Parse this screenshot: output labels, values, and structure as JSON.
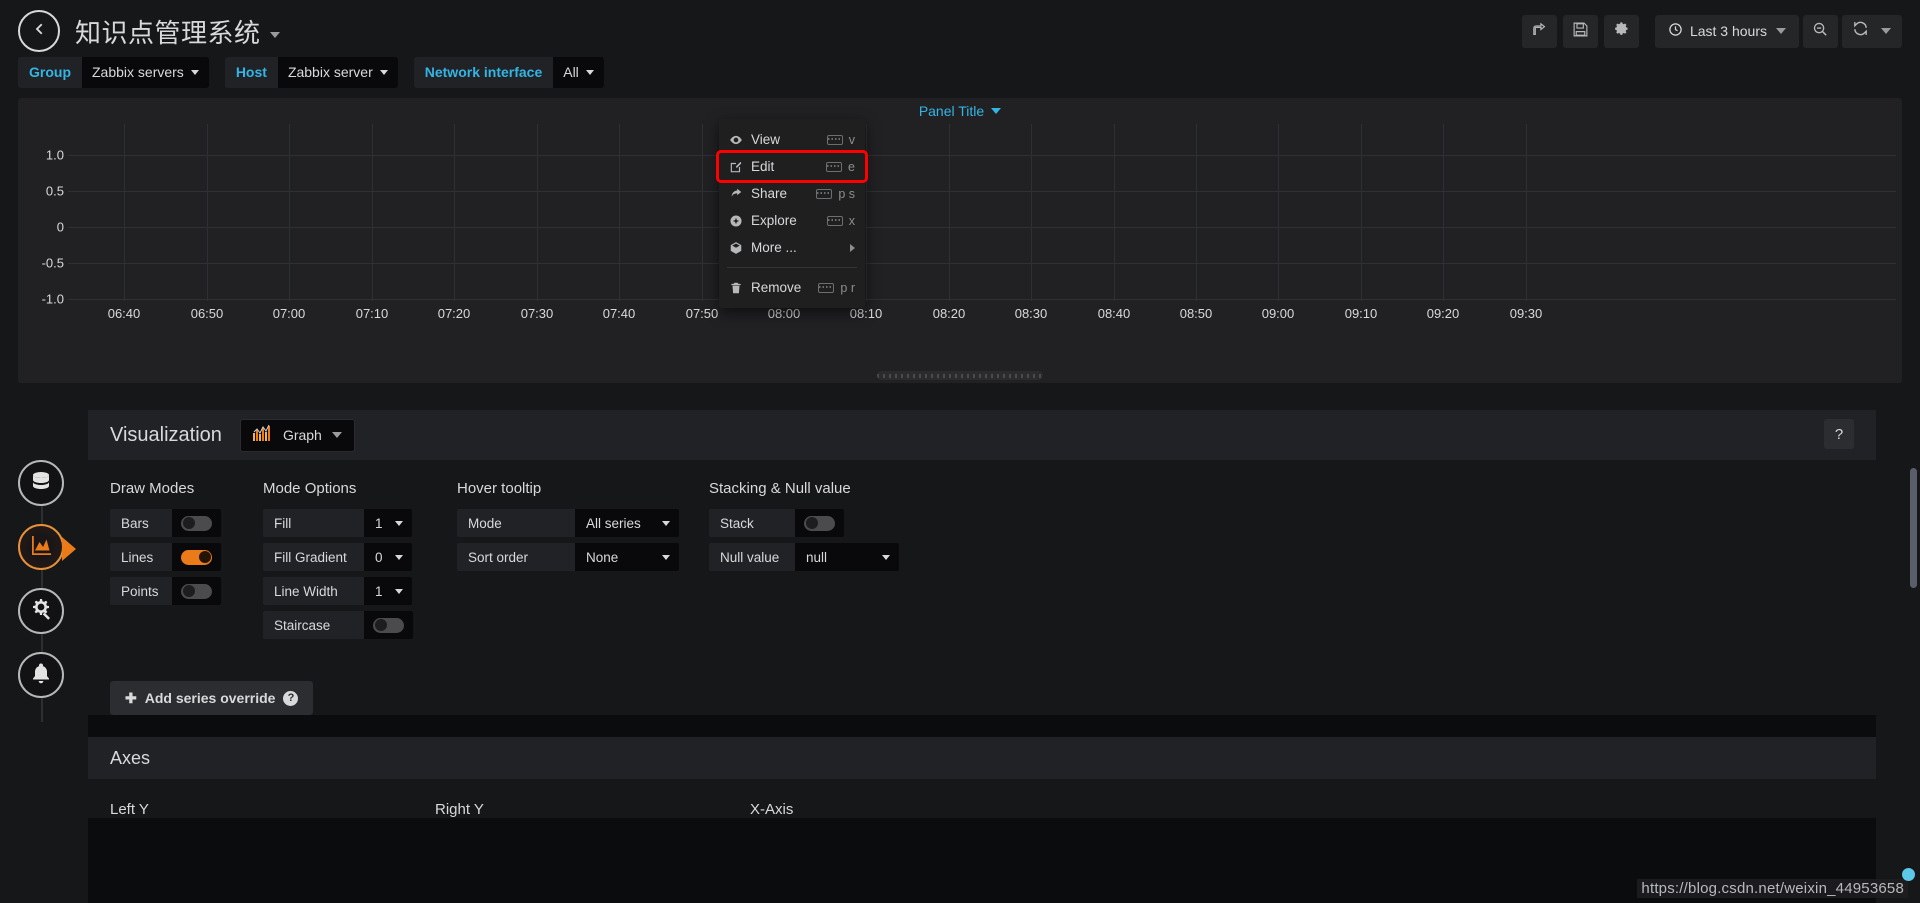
{
  "navbar": {
    "back_icon": "arrow-left-circle-icon",
    "dashboard_title": "知识点管理系统",
    "buttons": [
      {
        "name": "share-dashboard-button",
        "icon": "share-icon",
        "label": ""
      },
      {
        "name": "save-dashboard-button",
        "icon": "save-floppy-icon",
        "label": ""
      },
      {
        "name": "dashboard-settings-button",
        "icon": "gear-icon",
        "label": ""
      }
    ],
    "timepicker": {
      "label": "Last 3 hours",
      "icon": "clock-icon"
    },
    "zoom_out": {
      "name": "zoom-out-button",
      "icon": "search-minus-icon"
    },
    "refresh": {
      "name": "refresh-button",
      "icon": "refresh-icon"
    }
  },
  "template_vars": [
    {
      "label": "Group",
      "value": "Zabbix servers"
    },
    {
      "label": "Host",
      "value": "Zabbix server"
    },
    {
      "label": "Network interface",
      "value": "All"
    }
  ],
  "panel": {
    "title": "Panel Title",
    "y_ticks": [
      "1.0",
      "0.5",
      "0",
      "-0.5",
      "-1.0"
    ],
    "x_ticks": [
      "06:40",
      "06:50",
      "07:00",
      "07:10",
      "07:20",
      "07:30",
      "07:40",
      "07:50",
      "08:00",
      "08:10",
      "08:20",
      "08:30",
      "08:40",
      "08:50",
      "09:00",
      "09:10",
      "09:20",
      "09:30"
    ]
  },
  "chart_data": {
    "type": "line",
    "title": "Panel Title",
    "xlabel": "",
    "ylabel": "",
    "series": [],
    "x": [
      "06:40",
      "06:50",
      "07:00",
      "07:10",
      "07:20",
      "07:30",
      "07:40",
      "07:50",
      "08:00",
      "08:10",
      "08:20",
      "08:30",
      "08:40",
      "08:50",
      "09:00",
      "09:10",
      "09:20",
      "09:30"
    ],
    "ylim": [
      -1.0,
      1.0
    ],
    "yticks": [
      -1.0,
      -0.5,
      0,
      0.5,
      1.0
    ],
    "grid": true,
    "legend": "none",
    "note": "Empty graph — no data series plotted"
  },
  "panel_menu": {
    "items": [
      {
        "label": "View",
        "icon": "eye-icon",
        "shortcut": "v",
        "has_kbd": true,
        "highlighted": false,
        "submenu": false
      },
      {
        "label": "Edit",
        "icon": "edit-pencil-icon",
        "shortcut": "e",
        "has_kbd": true,
        "highlighted": true,
        "submenu": false
      },
      {
        "label": "Share",
        "icon": "share-arrow-icon",
        "shortcut": "p s",
        "has_kbd": true,
        "highlighted": false,
        "submenu": false
      },
      {
        "label": "Explore",
        "icon": "compass-icon",
        "shortcut": "x",
        "has_kbd": true,
        "highlighted": false,
        "submenu": false
      },
      {
        "label": "More ...",
        "icon": "cube-icon",
        "shortcut": "",
        "has_kbd": false,
        "highlighted": false,
        "submenu": true
      }
    ],
    "remove": {
      "label": "Remove",
      "icon": "trash-icon",
      "shortcut": "p r",
      "has_kbd": true
    },
    "highlight_color": "#ff0000"
  },
  "edit_sidebar": {
    "items": [
      {
        "name": "sidebar-tab-queries",
        "icon": "database-icon",
        "active": false
      },
      {
        "name": "sidebar-tab-visualization",
        "icon": "area-chart-icon",
        "active": true
      },
      {
        "name": "sidebar-tab-general",
        "icon": "gear-wrench-icon",
        "active": false
      },
      {
        "name": "sidebar-tab-alert",
        "icon": "bell-icon",
        "active": false
      }
    ],
    "active_color": "#eb7b18"
  },
  "visualization": {
    "section_title": "Visualization",
    "picker_value": "Graph",
    "picker_icon": "bar-chart-icon",
    "help_label": "?",
    "draw_modes": {
      "title": "Draw Modes",
      "rows": [
        {
          "label": "Bars",
          "type": "toggle",
          "on": false
        },
        {
          "label": "Lines",
          "type": "toggle",
          "on": true
        },
        {
          "label": "Points",
          "type": "toggle",
          "on": false
        }
      ]
    },
    "mode_options": {
      "title": "Mode Options",
      "rows": [
        {
          "label": "Fill",
          "type": "select",
          "value": "1"
        },
        {
          "label": "Fill Gradient",
          "type": "select",
          "value": "0"
        },
        {
          "label": "Line Width",
          "type": "select",
          "value": "1"
        },
        {
          "label": "Staircase",
          "type": "toggle",
          "on": false
        }
      ]
    },
    "hover_tooltip": {
      "title": "Hover tooltip",
      "rows": [
        {
          "label": "Mode",
          "type": "select",
          "value": "All series"
        },
        {
          "label": "Sort order",
          "type": "select",
          "value": "None"
        }
      ]
    },
    "stacking": {
      "title": "Stacking & Null value",
      "rows": [
        {
          "label": "Stack",
          "type": "toggle",
          "on": false
        },
        {
          "label": "Null value",
          "type": "select",
          "value": "null"
        }
      ]
    },
    "add_override_label": "Add series override"
  },
  "axes": {
    "section_title": "Axes",
    "columns": [
      "Left Y",
      "Right Y",
      "X-Axis"
    ]
  },
  "watermark": "https://blog.csdn.net/weixin_44953658"
}
